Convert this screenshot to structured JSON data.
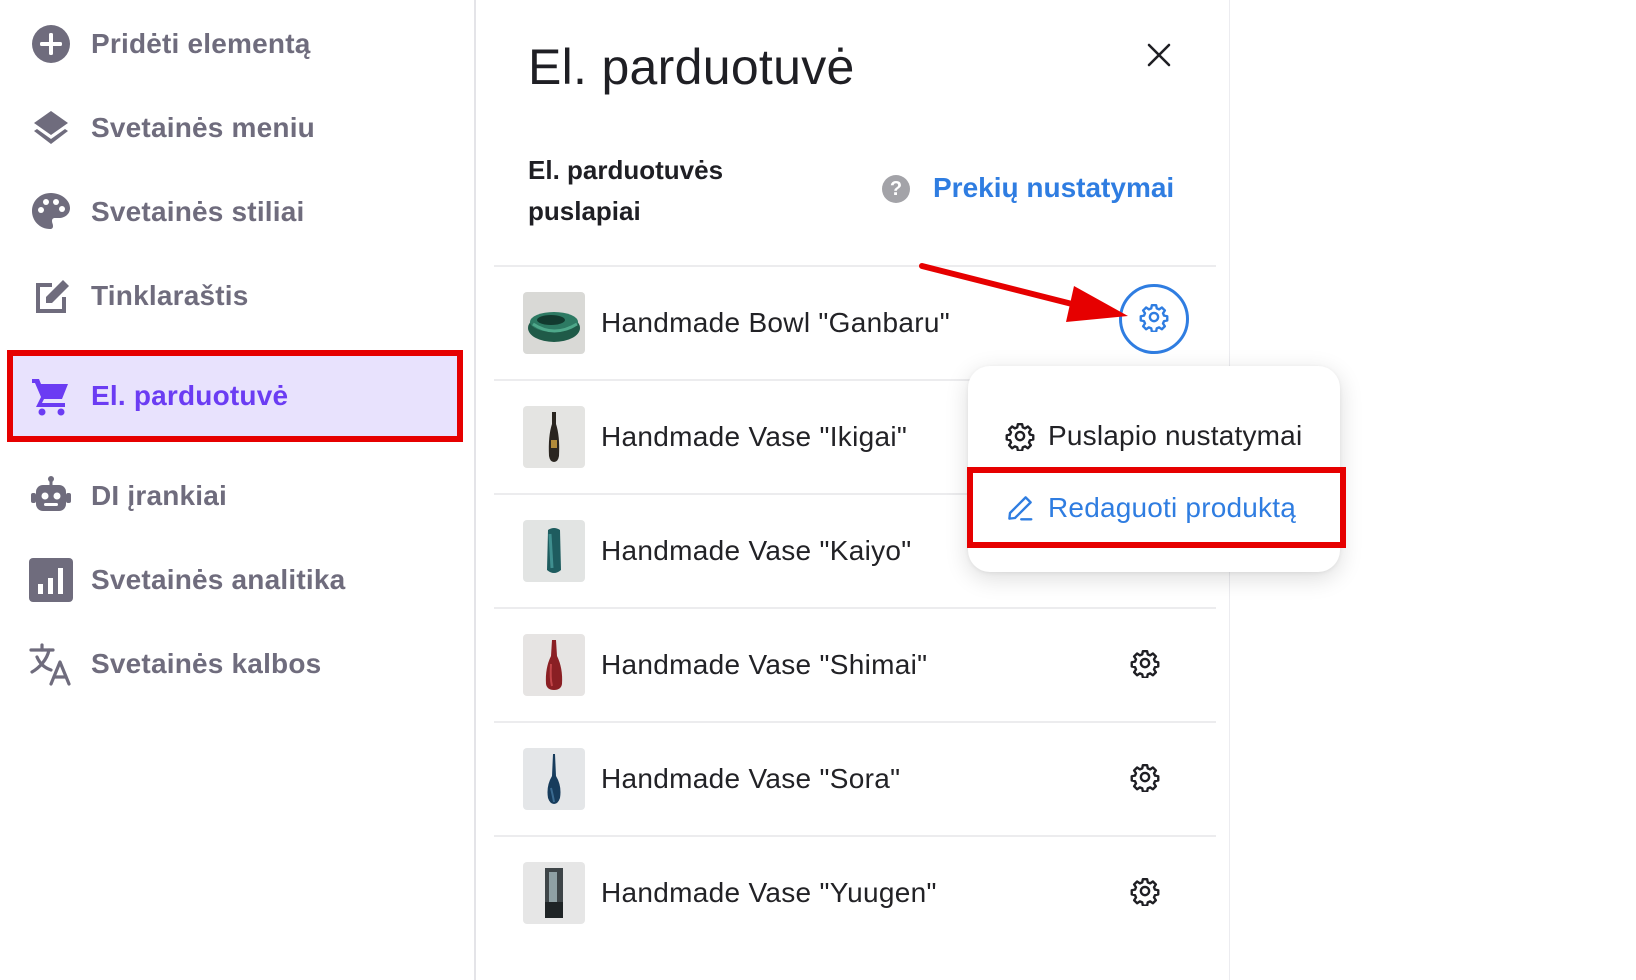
{
  "sidebar": {
    "items": [
      {
        "label": "Pridėti elementą",
        "icon": "plus-circle-icon"
      },
      {
        "label": "Svetainės meniu",
        "icon": "layers-icon"
      },
      {
        "label": "Svetainės stiliai",
        "icon": "palette-icon"
      },
      {
        "label": "Tinklaraštis",
        "icon": "edit-square-icon"
      },
      {
        "label": "El. parduotuvė",
        "icon": "cart-icon",
        "active": true
      },
      {
        "label": "DI įrankiai",
        "icon": "robot-icon"
      },
      {
        "label": "Svetainės analitika",
        "icon": "analytics-icon"
      },
      {
        "label": "Svetainės kalbos",
        "icon": "translate-icon"
      }
    ]
  },
  "panel": {
    "title": "El. parduotuvė",
    "section_label": "El. parduotuvės puslapiai",
    "help_symbol": "?",
    "settings_link": "Prekių nustatymai",
    "products": [
      {
        "name": "Handmade Bowl \"Ganbaru\"",
        "thumb": "bowl-green"
      },
      {
        "name": "Handmade Vase \"Ikigai\"",
        "thumb": "vase-dark"
      },
      {
        "name": "Handmade Vase \"Kaiyo\"",
        "thumb": "vase-teal"
      },
      {
        "name": "Handmade Vase \"Shimai\"",
        "thumb": "vase-red"
      },
      {
        "name": "Handmade Vase \"Sora\"",
        "thumb": "vase-blue"
      },
      {
        "name": "Handmade Vase \"Yuugen\"",
        "thumb": "vase-grey"
      }
    ]
  },
  "dropdown": {
    "items": [
      {
        "label": "Puslapio nustatymai",
        "icon": "gear-icon"
      },
      {
        "label": "Redaguoti produktą",
        "icon": "pencil-icon"
      }
    ]
  },
  "colors": {
    "accent_purple": "#6b3cf3",
    "active_bg": "#e8e2fd",
    "link_blue": "#2f7de1",
    "highlight_red": "#e60000",
    "sidebar_text": "#6f6c7d"
  }
}
